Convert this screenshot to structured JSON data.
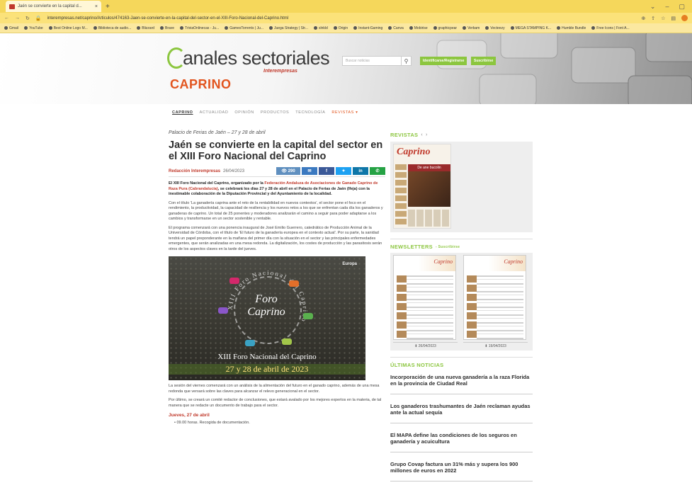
{
  "browser": {
    "tab_title": "Jaén se convierte en la capital d...",
    "tab_close": "×",
    "new_tab": "+",
    "url": "interempresas.net/caprino/Articulos/474163-Jaen-se-convierte-en-la-capital-del-sector-en-el-XIII-Foro-Nacional-del-Caprino.html",
    "bookmarks": [
      "Gmail",
      "YouTube",
      "Best Online Logo M...",
      "Biblioteca de audio...",
      "Blizzard",
      "Brave",
      "TriviaOnlinecas - Ju...",
      "GamesTorrents | Ju...",
      "Juega Strategy | Str...",
      "slnkld",
      "Origin",
      "Instant-Gaming",
      "Canva",
      "Mobirise",
      "graphicpear",
      "Verbam",
      "Vecteezy",
      "MEGA STAMPING K...",
      "Humble Bundle",
      "Free Icons | Font A..."
    ]
  },
  "header": {
    "logo_text": "anales sectoriales",
    "logo_sub": "Interempresas",
    "section": "CAPRINO",
    "search_placeholder": "Buscar noticias",
    "btn_identify": "Identificarse/Registrarse",
    "btn_subscribe": "Suscribirse"
  },
  "nav": {
    "items": [
      "CAPRINO",
      "ACTUALIDAD",
      "OPINIÓN",
      "PRODUCTOS",
      "TECNOLOGÍA"
    ],
    "revistas": "REVISTAS ▾"
  },
  "article": {
    "kicker": "Palacio de Ferias de Jaén – 27 y 28 de abril",
    "headline": "Jaén se convierte en la capital del sector en el XIII Foro Nacional del Caprino",
    "author": "Redacción Interempresas",
    "date": "26/04/2023",
    "views": "290",
    "lead_1": "El XIII Foro Nacional del Caprino, organizado por la ",
    "lead_hl": "Federación Andaluza de Asociaciones de Ganado Caprino de Raza Pura (Cabrandalucía)",
    "lead_2": ", se celebrará los días 27 y 28 de abril en el Palacio de Ferias de Jaén (Ifeja) con la inestimable colaboración de la Diputación Provincial y del Ayuntamiento de la localidad.",
    "para_1": "Con el título 'La ganadería caprina ante el reto de la rentabilidad en nuevos contextos', el sector pone el foco en el rendimiento, la productividad, la capacidad de resiliencia y los nuevos retos a los que se enfrentan cada día los ganaderos y ganaderas de caprino. Un total de 25 ponentes y moderadores analizarán el camino a seguir para poder adaptarse a los cambios y transformarse en un sector sostenible y rentable.",
    "para_2": "El programa comenzará con una ponencia inaugural de José Emilio Guerrero, catedrático de Producción Animal de la Universidad de Córdoba, con el título de 'El futuro de la ganadería europea en el contexto actual'. Por su parte, la sanidad tendrá un papel preponderante en la mañana del primer día con la situación en el sector y las principales enfermedades emergentes, que serán analizadas en una mesa redonda. La digitalización, los costes de producción y las parasitosis serán otros de los aspectos claves en la tarde del jueves.",
    "poster_foro": "Foro Caprino",
    "poster_ring": "XIII Foro Nacional del Caprino",
    "poster_europa": "Europa",
    "poster_title": "XIII Foro Nacional del Caprino",
    "poster_dates": "27 y 28 de abril de 2023",
    "para_3": "La sesión del viernes comenzará con un análisis de la alimentación del futuro en el ganado caprino, además de una mesa redonda que versará sobre las claves para alcanzar el relevo generacional en el sector.",
    "para_4": "Por último, se creará un comité redactor de conclusiones, que estará avalado por los mejores expertos en la materia, de tal manera que se redacte un documento de trabajo para el sector.",
    "subhead": "Jueves, 27 de abril",
    "bullet_1": "09.00 horas. Recogida de documentación."
  },
  "sidebar": {
    "revistas_h": "REVISTAS",
    "mag_title": "Caprino",
    "mag_banner": "De ane bucolin",
    "newsletters_h": "NEWSLETTERS",
    "newsletters_sub": "- Suscribirse",
    "nl_caption": "Caprino",
    "nl_dates": [
      "26/04/2023",
      "19/04/2023"
    ],
    "ultimas_h": "ÚLTIMAS NOTICIAS",
    "news": [
      "Incorporación de una nueva ganadería a la raza Florida en la provincia de Ciudad Real",
      "Los ganaderos trashumantes de Jaén reclaman ayudas ante la actual sequía",
      "El MAPA define las condiciones de los seguros en ganadería y acuicultura",
      "Grupo Covap factura un 31% más y supera los 900 millones de euros en 2022"
    ]
  },
  "colors": {
    "accent_green": "#8cc63f",
    "accent_orange": "#e2551f",
    "accent_red": "#c0392b"
  }
}
